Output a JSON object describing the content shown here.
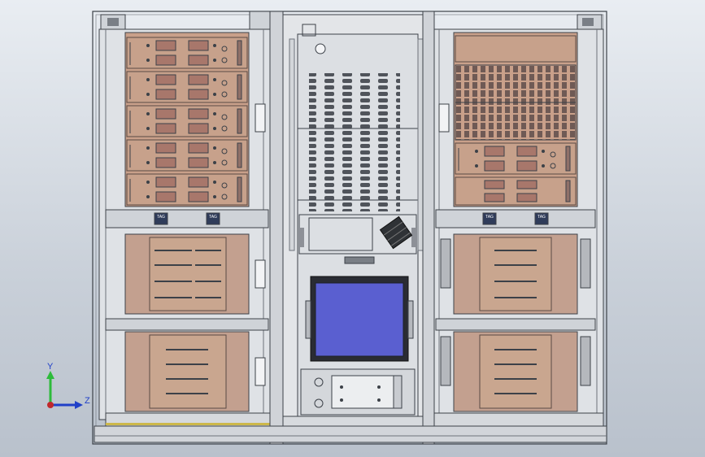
{
  "viewport": {
    "background_top": "#e9edf2",
    "background_bottom": "#b9c1cc"
  },
  "colors": {
    "frame_line": "#3c4148",
    "frame_fill": "#d3d6da",
    "rack_fill": "#e3e5e8",
    "module_fill": "#c9a08a",
    "module_dark": "#a8776b",
    "drawer_fill": "#c3a08f",
    "screen_fill": "#5a5fd0",
    "screen_bezel": "#2a2c33",
    "triad_x": "#c0282c",
    "triad_y": "#2dbb3b",
    "triad_z": "#2040c8"
  },
  "left_rack": {
    "label_plate_left": "TAG",
    "label_plate_right": "TAG"
  },
  "right_rack": {
    "label_plate_left": "TAG",
    "label_plate_right": "TAG"
  },
  "triad": {
    "y_label": "Y",
    "z_label": "Z",
    "icon": "axis-triad-icon"
  }
}
